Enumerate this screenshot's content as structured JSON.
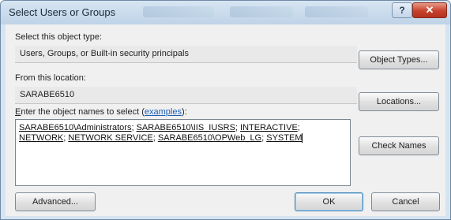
{
  "window": {
    "title": "Select Users or Groups",
    "help_glyph": "?",
    "close_glyph": "✕"
  },
  "object_type": {
    "label": "Select this object type:",
    "value": "Users, Groups, or Built-in security principals",
    "button": "Object Types..."
  },
  "location": {
    "label": "From this location:",
    "value": "SARABE6510",
    "button": "Locations..."
  },
  "names": {
    "label_accel": "E",
    "label_rest": "nter the object names to select (",
    "label_link": "examples",
    "label_end": "):",
    "line1": [
      {
        "text": "SARABE6510\\Administrators",
        "sep": "; "
      },
      {
        "text": "SARABE6510\\IIS_IUSRS",
        "sep": "; "
      },
      {
        "text": "INTERACTIVE",
        "sep": ";"
      }
    ],
    "line2": [
      {
        "text": "NETWORK",
        "sep": "; "
      },
      {
        "text": "NETWORK SERVICE",
        "sep": "; "
      },
      {
        "text": "SARABE6510\\OPWeb_LG",
        "sep": "; "
      },
      {
        "text": "SYSTEM",
        "sep": ""
      }
    ],
    "check_button": "Check Names"
  },
  "footer": {
    "advanced_button": "Advanced...",
    "ok_button": "OK",
    "cancel_button": "Cancel"
  }
}
